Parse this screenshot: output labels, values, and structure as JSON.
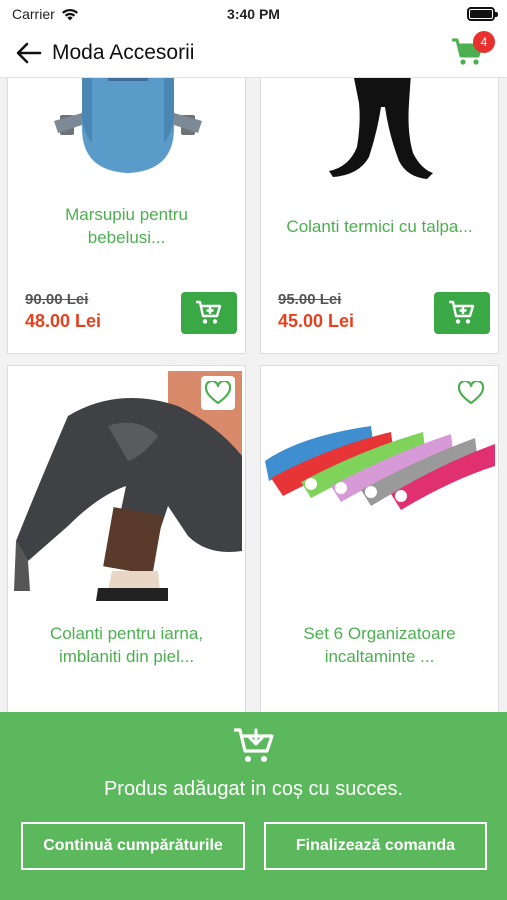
{
  "status": {
    "carrier": "Carrier",
    "time": "3:40 PM"
  },
  "header": {
    "title": "Moda Accesorii",
    "cart_count": "4"
  },
  "products": [
    {
      "name_line1": "Marsupiu pentru",
      "name_line2": "bebelusi...",
      "old_price": "90.00 Lei",
      "new_price": "48.00 Lei"
    },
    {
      "name_line1": "Colanti termici cu talpa...",
      "name_line2": "",
      "old_price": "95.00 Lei",
      "new_price": "45.00 Lei"
    },
    {
      "name_line1": "Colanti pentru iarna,",
      "name_line2": "imblaniti din piel..."
    },
    {
      "name_line1": "Set 6 Organizatoare",
      "name_line2": "incaltaminte ..."
    }
  ],
  "toast": {
    "message": "Produs adăugat in coș cu succes.",
    "continue_label": "Continuă cumpărăturile",
    "checkout_label": "Finalizează comanda"
  },
  "colors": {
    "brand_green": "#4caf50",
    "button_green": "#3aa845",
    "toast_green": "#5cb85c",
    "price_red": "#e8401c",
    "badge_red": "#e8302f"
  }
}
